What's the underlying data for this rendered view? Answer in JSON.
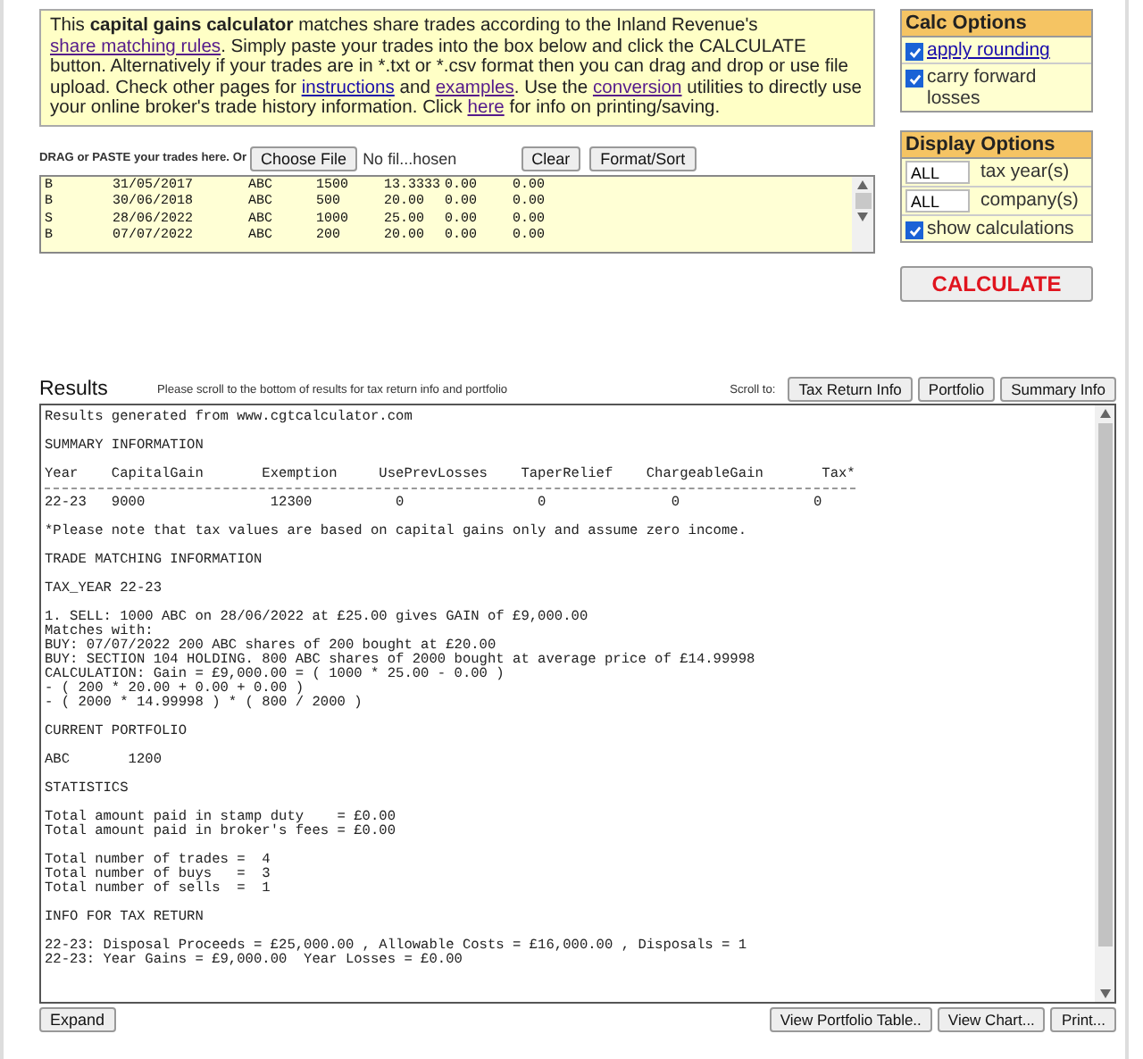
{
  "intro": [
    {
      "kind": "text",
      "text": "This "
    },
    {
      "kind": "bold",
      "text": "capital gains calculator"
    },
    {
      "kind": "text",
      "text": " matches share trades according to the Inland Revenue's "
    },
    {
      "kind": "link",
      "text": "share matching rules"
    },
    {
      "kind": "text",
      "text": ". Simply paste your trades into the box below and click the CALCULATE button. Alternatively if your trades are in *.txt or *.csv format then you can drag and drop or use file upload. Check other pages for "
    },
    {
      "kind": "link",
      "text": "instructions"
    },
    {
      "kind": "text",
      "text": " and "
    },
    {
      "kind": "link",
      "text": "examples"
    },
    {
      "kind": "text",
      "text": ". Use the "
    },
    {
      "kind": "link",
      "text": "conversion"
    },
    {
      "kind": "text",
      "text": " utilities to directly use your online broker's trade history information. Click "
    },
    {
      "kind": "link",
      "text": "here"
    },
    {
      "kind": "text",
      "text": " for info on printing/saving."
    }
  ],
  "upload": {
    "label": "DRAG or PASTE your trades here. Or",
    "choose_button": "Choose File",
    "file_name": "No fil...hosen",
    "buttons": [
      "Clear",
      "Format/Sort"
    ]
  },
  "trades": [
    [
      "B",
      "31/05/2017",
      "ABC",
      "1500",
      "13.3333",
      "0.00",
      "0.00"
    ],
    [
      "B",
      "30/06/2018",
      "ABC",
      "500",
      "20.00",
      "0.00",
      "0.00"
    ],
    [
      "S",
      "28/06/2022",
      "ABC",
      "1000",
      "25.00",
      "0.00",
      "0.00"
    ],
    [
      "B",
      "07/07/2022",
      "ABC",
      "200",
      "20.00",
      "0.00",
      "0.00"
    ]
  ],
  "calc_options": {
    "title": "Calc Options",
    "items": [
      {
        "label": "apply rounding",
        "checked": true,
        "kind": "link"
      },
      {
        "label": "carry forward losses",
        "checked": true,
        "kind": "text"
      }
    ]
  },
  "display_options": {
    "title": "Display Options",
    "fields": [
      {
        "value": "ALL",
        "label": "tax year(s)"
      },
      {
        "value": "ALL",
        "label": "company(s)"
      }
    ],
    "items": [
      {
        "label": "show calculations",
        "checked": true
      }
    ]
  },
  "calculate_button": "CALCULATE",
  "results": {
    "title": "Results",
    "note": "Please scroll to the bottom of results for tax return info and portfolio",
    "scroll_label": "Scroll to:",
    "scroll_buttons": [
      "Tax Return Info",
      "Portfolio",
      "Summary Info"
    ],
    "blocks": [
      [
        "Results generated from www.cgtcalculator.com"
      ],
      [
        "SUMMARY INFORMATION"
      ],
      [
        "Year    CapitalGain       Exemption     UsePrevLosses    TaperRelief    ChargeableGain       Tax*"
      ],
      [
        "22-23   9000               12300          0                0               0                0"
      ],
      [
        "*Please note that tax values are based on capital gains only and assume zero income."
      ],
      [
        "TRADE MATCHING INFORMATION"
      ],
      [
        "TAX_YEAR 22-23"
      ],
      [
        "1. SELL: 1000 ABC on 28/06/2022 at £25.00 gives GAIN of £9,000.00",
        "Matches with:",
        "BUY: 07/07/2022 200 ABC shares of 200 bought at £20.00",
        "BUY: SECTION 104 HOLDING. 800 ABC shares of 2000 bought at average price of £14.99998",
        "CALCULATION: Gain = £9,000.00 = ( 1000 * 25.00 - 0.00 )",
        "- ( 200 * 20.00 + 0.00 + 0.00 )",
        "- ( 2000 * 14.99998 ) * ( 800 / 2000 )"
      ],
      [
        "CURRENT PORTFOLIO"
      ],
      [
        "ABC       1200"
      ],
      [
        "STATISTICS"
      ],
      [
        "Total amount paid in stamp duty    = £0.00",
        "Total amount paid in broker's fees = £0.00"
      ],
      [
        "Total number of trades =  4",
        "Total number of buys   =  3",
        "Total number of sells  =  1"
      ],
      [
        "INFO FOR TAX RETURN"
      ],
      [
        "22-23: Disposal Proceeds = £25,000.00 , Allowable Costs = £16,000.00 , Disposals = 1",
        "22-23: Year Gains = £9,000.00  Year Losses = £0.00"
      ]
    ],
    "expand_button": "Expand",
    "bottom_buttons": [
      "View Portfolio Table..",
      "View Chart...",
      "Print..."
    ]
  }
}
